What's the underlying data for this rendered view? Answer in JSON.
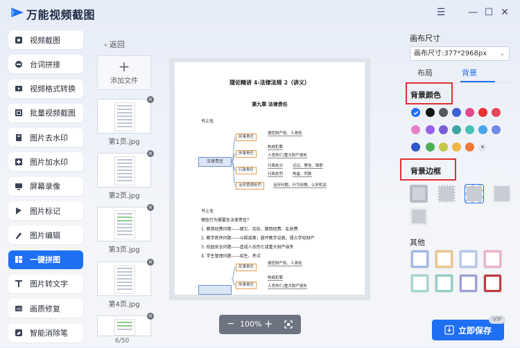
{
  "app": {
    "title": "万能视频截图",
    "brand_color": "#1f6ff2"
  },
  "window_controls": {
    "menu": "☰",
    "minimize": "—",
    "maximize": "☐",
    "close": "✕"
  },
  "sidebar": {
    "items": [
      {
        "label": "视频截图",
        "icon": "video-screenshot-icon"
      },
      {
        "label": "台词拼接",
        "icon": "subtitle-stitch-icon"
      },
      {
        "label": "视频格式转换",
        "icon": "video-convert-icon"
      },
      {
        "label": "批量视频截图",
        "icon": "batch-screenshot-icon"
      },
      {
        "label": "图片去水印",
        "icon": "remove-watermark-icon"
      },
      {
        "label": "图片加水印",
        "icon": "add-watermark-icon"
      },
      {
        "label": "屏幕录像",
        "icon": "screen-record-icon"
      },
      {
        "label": "图片标记",
        "icon": "image-mark-icon"
      },
      {
        "label": "图片编辑",
        "icon": "image-edit-icon"
      },
      {
        "label": "一键拼图",
        "icon": "collage-icon",
        "active": true
      },
      {
        "label": "图片转文字",
        "icon": "ocr-icon"
      },
      {
        "label": "画质修复",
        "icon": "quality-repair-icon"
      },
      {
        "label": "智能消除笔",
        "icon": "eraser-icon"
      }
    ]
  },
  "files": {
    "back_label": "返回",
    "add_label": "添加文件",
    "pages": [
      {
        "caption": "第1页.jpg"
      },
      {
        "caption": "第2页.jpg"
      },
      {
        "caption": "第3页.jpg"
      },
      {
        "caption": "第4页.jpg"
      },
      {
        "caption": ""
      }
    ],
    "pager": "6/50"
  },
  "preview": {
    "doc_title": "理论精讲 4-法律法规 2（讲义）",
    "chapter": "第九章  法律责任",
    "lines_top": [
      "书上无"
    ],
    "root_node": "法律责任",
    "nodes": [
      "民事责任",
      "刑事责任",
      "行政责任",
      "治安管理处罚"
    ],
    "leaves": [
      "侵犯财产权、人身权",
      "构成犯罪",
      "人员伤亡/重大财产损失",
      "行政处分",
      "记过、警告、降职",
      "行政处罚",
      "拘留、罚款",
      "治安问题，行为轻微，公安机关"
    ],
    "section2_head": "书上无",
    "questions": [
      "哪些行为需要负法律责任？",
      "1. 教育经费问题——挪欠、克扣、挪用经费、乱收费",
      "2. 教学秩序问题——斗殴滋事；毁坏教学设施，侵占学校财产",
      "3. 校园安全问题——造成人员伤亡或重大财产损失",
      "4. 学生管理问题——招生、考试"
    ],
    "nodes2": [
      "民事责任",
      "刑事责任"
    ],
    "leaves2": [
      "侵犯财产权、人身权",
      "构成犯罪",
      "人员伤亡/重大财产损失"
    ]
  },
  "zoom": {
    "minus": "−",
    "value": "100%",
    "plus": "+",
    "fit_icon": "fit-screen-icon"
  },
  "right_panel": {
    "canvas_size_label": "画布尺寸",
    "canvas_size_value": "画布尺寸:377*2968px",
    "tabs": [
      "布局",
      "背景"
    ],
    "active_tab": "背景",
    "bg_color_label": "背景颜色",
    "colors": [
      "#ffffff",
      "#111111",
      "#55585f",
      "#3a62d6",
      "#e24a8c",
      "#e53232",
      "#e8445a",
      "#e67fc8",
      "#9a5fe8",
      "#7a5bd6",
      "#3fa5a2",
      "#45c2b6",
      "#4aa6ea",
      "#6e89e8",
      "#2e58c9",
      "#4db058",
      "#c3c94a",
      "#f2b441",
      "#f07a36"
    ],
    "bg_border_label": "背景边框",
    "other_label": "其他",
    "save_label": "立即保存",
    "vip_label": "VIP"
  }
}
